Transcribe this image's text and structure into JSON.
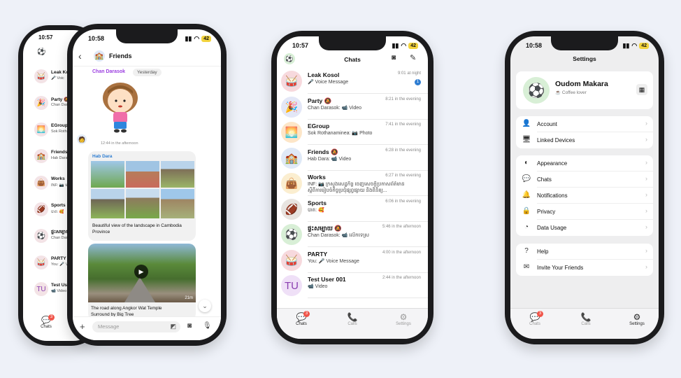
{
  "left_phone": {
    "back_time": "10:57",
    "back_items": [
      {
        "name": "Leak Kosol",
        "preview": "🎤 Voic",
        "icon": "🥁"
      },
      {
        "name": "Party 🔕",
        "preview": "Chan Daras",
        "icon": "🎉"
      },
      {
        "name": "EGroup",
        "preview": "Sok Rothan",
        "icon": "🌅"
      },
      {
        "name": "Friends",
        "preview": "Hab Dara:",
        "icon": "🏫"
      },
      {
        "name": "Works",
        "preview": "INF: 📷 ម",
        "icon": "👜"
      },
      {
        "name": "Sports",
        "preview": "បាត: 🥰",
        "icon": "🏈"
      },
      {
        "name": "ផ្ទះសម្បាយ",
        "preview": "Chan Daras",
        "icon": "⚽"
      },
      {
        "name": "PARTY",
        "preview": "You: 🎤 V",
        "icon": "🥁"
      },
      {
        "name": "Test User 0",
        "preview": "📹 Video",
        "icon": "TU"
      }
    ],
    "back_tab_label": "Chats",
    "back_tab_badge": "3",
    "time": "10:58",
    "battery": "42",
    "chat_title": "Friends",
    "sender": "Chan Darasok",
    "date_chip": "Yesterday",
    "sticker_time": "12:44 in the afternoon",
    "album_sender": "Hab Dara",
    "album_caption": "Beautiful view of the landscape in Cambodia Province",
    "video_duration": "21m",
    "video_caption": "The road along Angkor Wat Temple Surround by Big Tree",
    "input_placeholder": "Message"
  },
  "middle_phone": {
    "time": "10:57",
    "battery": "42",
    "title": "Chats",
    "chats": [
      {
        "name": "Leak Kosol",
        "preview": "🎤 Voice Message",
        "time": "9:01 at night",
        "unread": "1",
        "icon": "🥁",
        "bg": "#f7d9dd"
      },
      {
        "name": "Party 🔕",
        "preview": "Chan Darasok: 📹 Video",
        "time": "8:21 in the evening",
        "unread": "",
        "icon": "🎉",
        "bg": "#e3e7f7"
      },
      {
        "name": "EGroup",
        "preview": "Sok Rothanaminea: 📷 Photo",
        "time": "7:41 in the evening",
        "unread": "",
        "icon": "🌅",
        "bg": "#fde6c8"
      },
      {
        "name": "Friends 🔕",
        "preview": "Hab Dara: 📹 Video",
        "time": "6:28 in the evening",
        "unread": "",
        "icon": "🏫",
        "bg": "#dfe9f7"
      },
      {
        "name": "Works",
        "preview": "INF: 📷 ក្រសួងសេដ្ឋកិច្ច ​ចេញសេចក្ដីប្រកាសព័ត៌មាន ស្ដីពីការរៀបចំកិច្ចប្រជុំផ្សព្វផ្សាយ និងពិនិត្យ...",
        "time": "6:27 in the evening",
        "unread": "",
        "icon": "👜",
        "bg": "#fbeed0"
      },
      {
        "name": "Sports",
        "preview": "បាត: 🥰",
        "time": "6:06 in the evening",
        "unread": "",
        "icon": "🏈",
        "bg": "#e8e4e0"
      },
      {
        "name": "ផ្ទះសម្បាយ 🔕",
        "preview": "Chan Darasok: 📹 ​លើកទេស្រ",
        "time": "5:46 in the afternoon",
        "unread": "",
        "icon": "⚽",
        "bg": "#d8efd6"
      },
      {
        "name": "PARTY",
        "preview": "You: 🎤 Voice Message",
        "time": "4:00 in the afternoon",
        "unread": "",
        "icon": "🥁",
        "bg": "#f7d9dd"
      },
      {
        "name": "Test User 001",
        "preview": "📹 Video",
        "time": "2:44 in the afternoon",
        "unread": "",
        "icon": "TU",
        "bg": "#efe0f7"
      }
    ],
    "tabs": [
      {
        "label": "Chats",
        "icon": "💬",
        "badge": "3"
      },
      {
        "label": "Calls",
        "icon": "📞",
        "badge": ""
      },
      {
        "label": "Settings",
        "icon": "⚙",
        "badge": ""
      }
    ]
  },
  "right_phone": {
    "time": "10:58",
    "battery": "42",
    "title": "Settings",
    "profile_name": "Oudom Makara",
    "profile_status": "☕ Coffee lover",
    "group1": [
      {
        "label": "Account",
        "icon": "👤"
      },
      {
        "label": "Linked Devices",
        "icon": "🖥"
      }
    ],
    "group2": [
      {
        "label": "Appearance",
        "icon": "◐"
      },
      {
        "label": "Chats",
        "icon": "💬"
      },
      {
        "label": "Notifications",
        "icon": "🔔"
      },
      {
        "label": "Privacy",
        "icon": "🔒"
      },
      {
        "label": "Data Usage",
        "icon": "◔"
      }
    ],
    "group3": [
      {
        "label": "Help",
        "icon": "?"
      },
      {
        "label": "Invite Your Friends",
        "icon": "✉"
      }
    ],
    "tabs": [
      {
        "label": "Chats",
        "icon": "💬",
        "badge": "3"
      },
      {
        "label": "Calls",
        "icon": "📞",
        "badge": ""
      },
      {
        "label": "Settings",
        "icon": "⚙",
        "badge": ""
      }
    ]
  }
}
